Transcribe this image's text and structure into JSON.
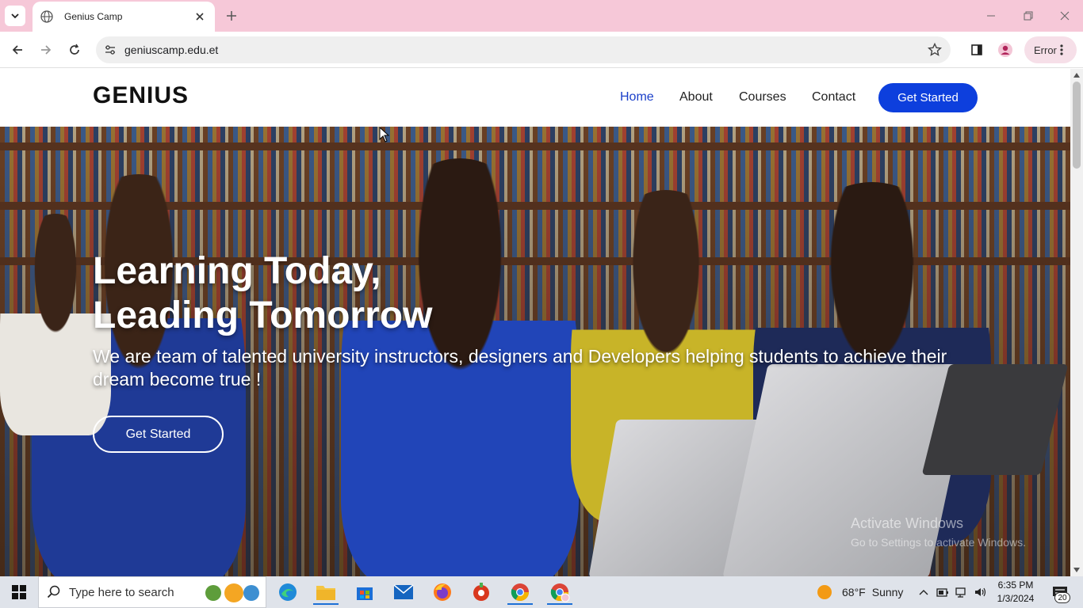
{
  "browser": {
    "tab_title": "Genius Camp",
    "url": "geniuscamp.edu.et",
    "error_label": "Error"
  },
  "site": {
    "logo": "GENIUS",
    "nav": [
      {
        "label": "Home"
      },
      {
        "label": "About"
      },
      {
        "label": "Courses"
      },
      {
        "label": "Contact"
      }
    ],
    "header_cta": "Get Started",
    "hero": {
      "title_line1": "Learning Today,",
      "title_line2": "Leading Tomorrow",
      "subtitle": "We are team of talented university instructors, designers and Developers helping students to achieve their dream become true !",
      "cta": "Get Started"
    }
  },
  "watermark": {
    "line1": "Activate Windows",
    "line2": "Go to Settings to activate Windows."
  },
  "taskbar": {
    "search_placeholder": "Type here to search",
    "weather": {
      "temp": "68°F",
      "condition": "Sunny"
    },
    "time": "6:35 PM",
    "date": "1/3/2024",
    "notifications": "20"
  },
  "colors": {
    "accent_blue": "#0d3fdd",
    "tabstrip_pink": "#f6c8d8"
  }
}
